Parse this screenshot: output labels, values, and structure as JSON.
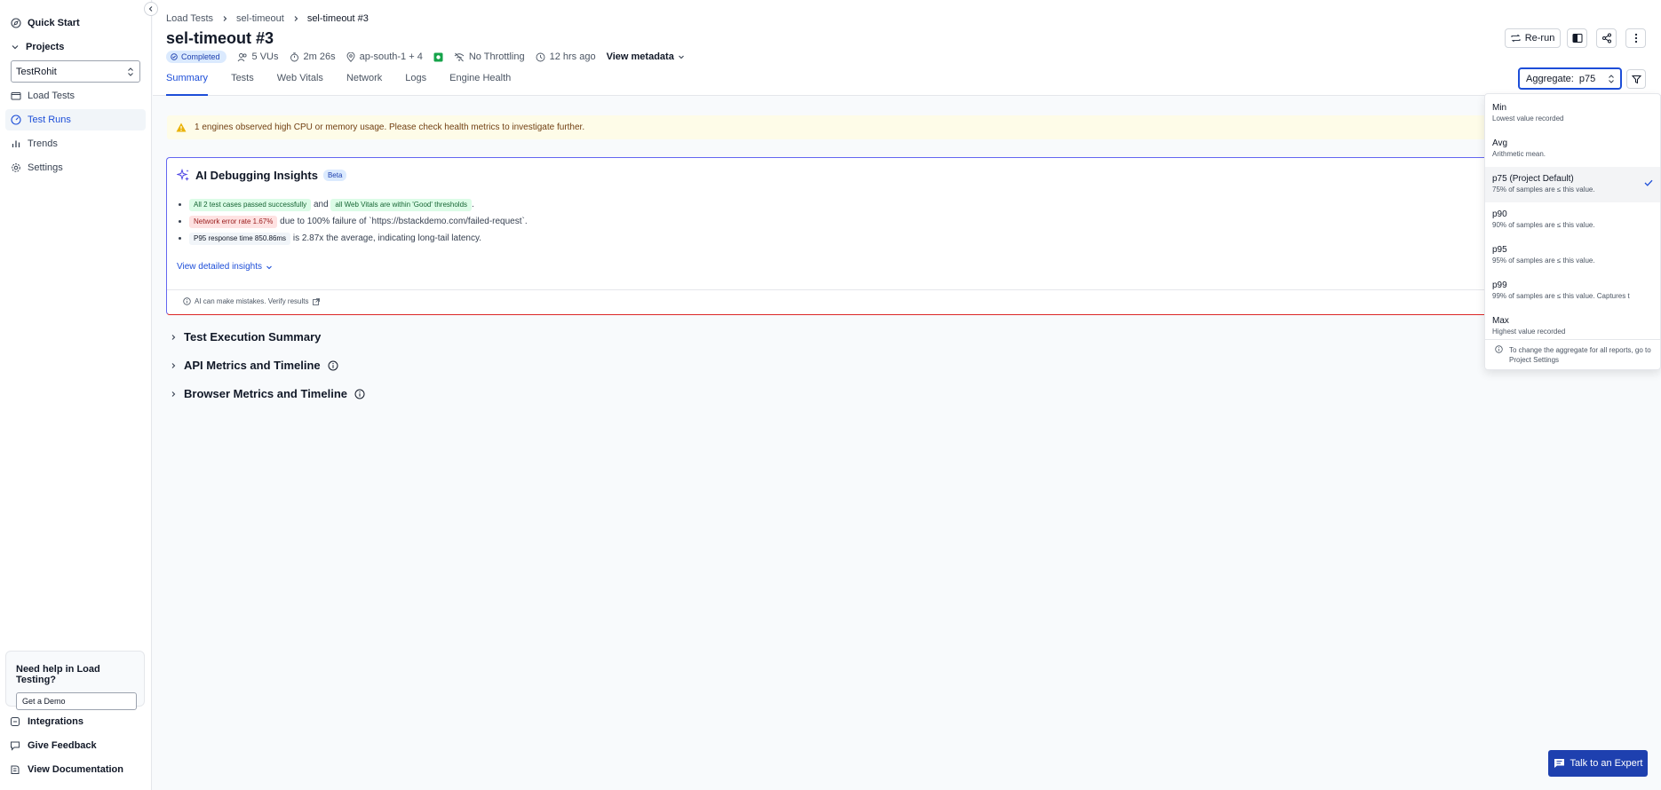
{
  "sidebar": {
    "quick_start": "Quick Start",
    "projects": "Projects",
    "project_selected": "TestRohit",
    "items": [
      {
        "label": "Load Tests"
      },
      {
        "label": "Test Runs"
      },
      {
        "label": "Trends"
      },
      {
        "label": "Settings"
      }
    ],
    "help": {
      "title": "Need help in Load Testing?",
      "button": "Get a Demo"
    },
    "bottom": [
      {
        "label": "Integrations"
      },
      {
        "label": "Give Feedback"
      },
      {
        "label": "View Documentation"
      }
    ]
  },
  "header": {
    "breadcrumb": [
      "Load Tests",
      "sel-timeout",
      "sel-timeout #3"
    ],
    "title": "sel-timeout #3",
    "meta": {
      "status": "Completed",
      "vus": "5 VUs",
      "duration": "2m 26s",
      "region": "ap-south-1 + 4",
      "throttling": "No Throttling",
      "time_ago": "12 hrs ago",
      "view_metadata": "View metadata"
    },
    "tabs": [
      "Summary",
      "Tests",
      "Web Vitals",
      "Network",
      "Logs",
      "Engine Health"
    ],
    "rerun": "Re-run",
    "aggregate_label": "Aggregate:",
    "aggregate_value": "p75"
  },
  "alert": "1 engines observed high CPU or memory usage. Please check health metrics to investigate further.",
  "ai": {
    "title": "AI Debugging Insights",
    "badge": "Beta",
    "insight1": {
      "pill1": "All 2 test cases passed successfully",
      "mid": "and",
      "pill2": "all Web Vitals are within 'Good' thresholds",
      "end": "."
    },
    "insight2": {
      "pill": "Network error rate 1.67%",
      "text": "due to 100% failure of `https://bstackdemo.com/failed-request`."
    },
    "insight3": {
      "pill": "P95 response time 850.86ms",
      "text": "is 2.87x the average, indicating long-tail latency."
    },
    "view_detailed": "View detailed insights",
    "disclaimer": "AI can make mistakes. Verify results"
  },
  "sections": [
    "Test Execution Summary",
    "API Metrics and Timeline",
    "Browser Metrics and Timeline"
  ],
  "dropdown": {
    "options": [
      {
        "label": "Min",
        "desc": "Lowest value recorded"
      },
      {
        "label": "Avg",
        "desc": "Arithmetic mean."
      },
      {
        "label": "p75  (Project Default)",
        "desc": "75% of samples are ≤ this value."
      },
      {
        "label": "p90",
        "desc": "90% of samples are ≤ this value."
      },
      {
        "label": "p95",
        "desc": "95% of samples are ≤ this value."
      },
      {
        "label": "p99",
        "desc": "99% of samples are ≤ this value. Captures t"
      },
      {
        "label": "Max",
        "desc": "Highest value recorded"
      }
    ],
    "footer": "To change the aggregate for all reports, go to Project Settings"
  },
  "expert_button": "Talk to an Expert",
  "colors": {
    "accent": "#1d4ed8",
    "expert_bg": "#1e40af",
    "warning_bg": "#fefce8",
    "warning_icon": "#eab308"
  }
}
